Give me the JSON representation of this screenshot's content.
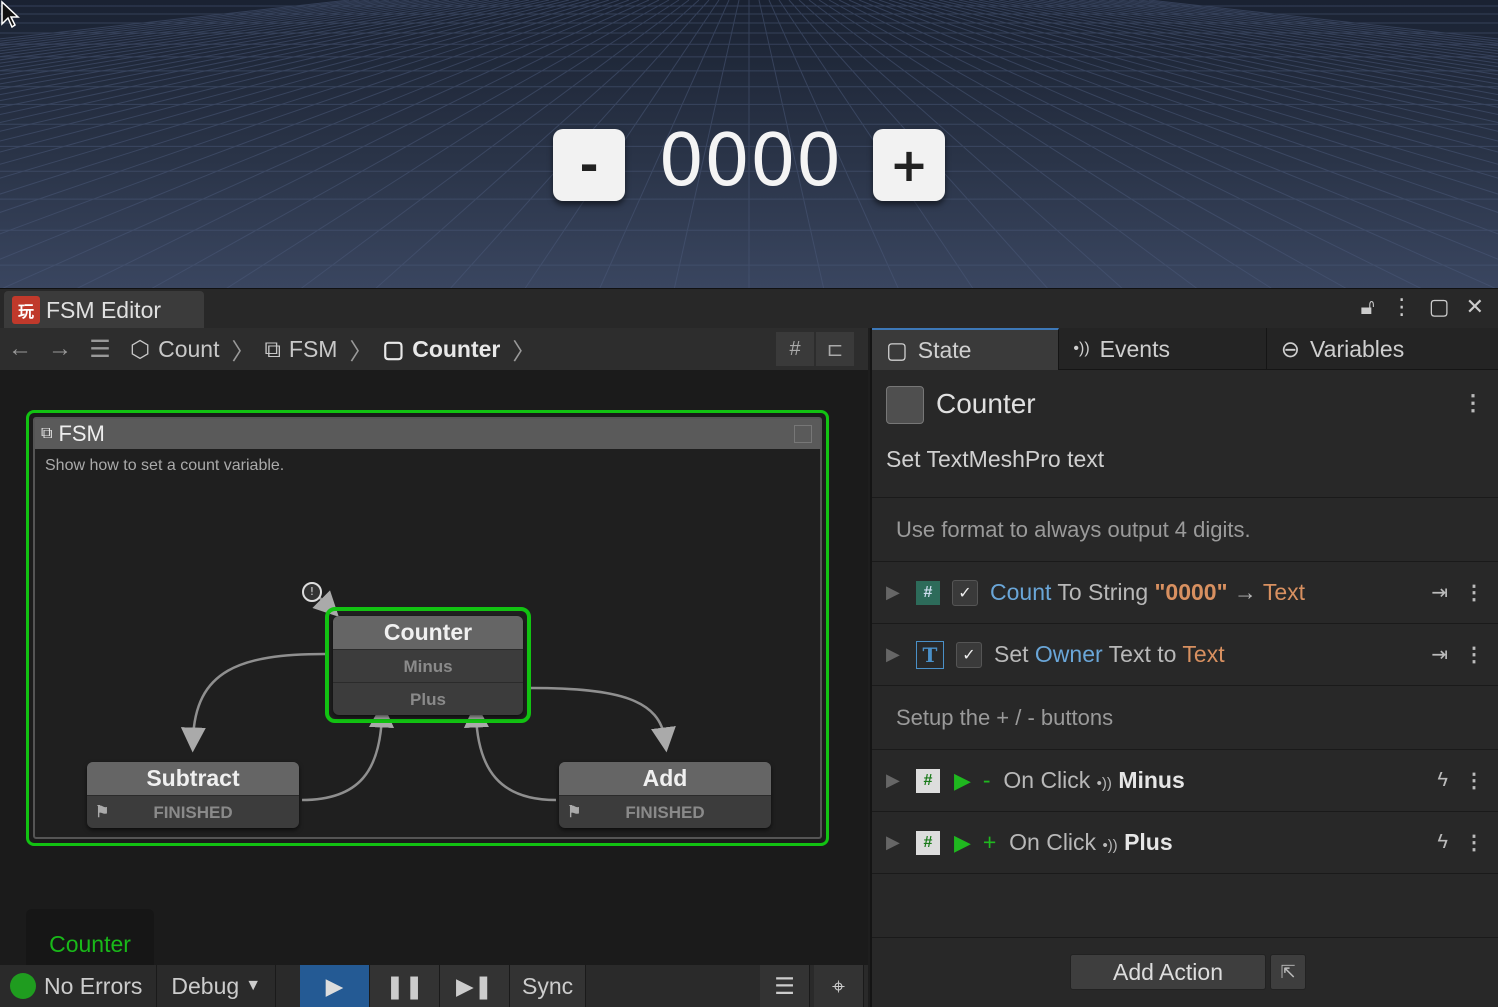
{
  "scene": {
    "minus_label": "-",
    "plus_label": "+",
    "counter_value": "0000"
  },
  "window": {
    "title": "FSM Editor"
  },
  "breadcrumb": {
    "items": [
      "Count",
      "FSM",
      "Counter"
    ]
  },
  "fsm": {
    "title": "FSM",
    "description": "Show how to set a count variable.",
    "states": {
      "counter": {
        "name": "Counter",
        "events": [
          "Minus",
          "Plus"
        ]
      },
      "subtract": {
        "name": "Subtract",
        "events": [
          "FINISHED"
        ]
      },
      "add": {
        "name": "Add",
        "events": [
          "FINISHED"
        ]
      }
    },
    "current_state": "Counter"
  },
  "status": {
    "errors": "No Errors",
    "debug": "Debug",
    "sync": "Sync"
  },
  "inspector": {
    "tabs": [
      "State",
      "Events",
      "Variables"
    ],
    "state_name": "Counter",
    "state_description": "Set TextMeshPro text",
    "comment1": "Use format to always output 4 digits.",
    "action1": {
      "var": "Count",
      "mid": "To String",
      "format": "\"0000\"",
      "arrow": "→",
      "target": "Text"
    },
    "action2": {
      "pre": "Set",
      "var": "Owner",
      "mid": "Text to",
      "target": "Text"
    },
    "comment2": "Setup the + / - buttons",
    "action3": {
      "sym": "-",
      "mid": "On Click",
      "event": "Minus"
    },
    "action4": {
      "sym": "+",
      "mid": "On Click",
      "event": "Plus"
    },
    "add_action": "Add Action"
  },
  "colors": {
    "active_state": "#12c212",
    "play_button": "#245a94",
    "status_ok": "#1f9c1f"
  }
}
